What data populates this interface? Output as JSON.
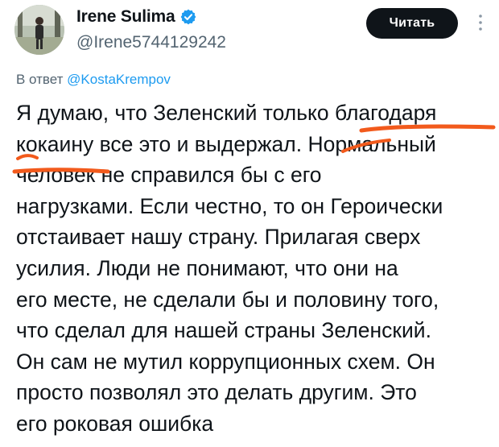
{
  "author": {
    "display_name": "Irene Sulima",
    "handle": "@Irene5744129242",
    "avatar_icon": "avatar-photo",
    "verified_icon": "verified-badge-icon",
    "verified_color": "#1d9bf0"
  },
  "follow_button": {
    "label": "Читать"
  },
  "more_icon": "more-vertical-icon",
  "reply": {
    "prefix": "В ответ ",
    "mention": "@KostaKrempov"
  },
  "tweet": {
    "lines": [
      "Я думаю, что Зеленский только благодаря",
      "кокаину все это и выдержал. Нормальный",
      "человек не справился бы с его",
      "нагрузками. Если честно, то он Героически",
      "отстаивает нашу страну. Прилагая сверх",
      "усилия. Люди не понимают, что они на",
      "его месте, не сделали бы и половину того,",
      "что сделал для нашей страны Зеленский.",
      "Он сам не мутил коррупционных схем. Он",
      "просто позволял это делать другим. Это",
      "его роковая ошибка"
    ]
  },
  "colors": {
    "text": "#0f1419",
    "secondary": "#536471",
    "link": "#1d9bf0",
    "highlight": "#f25a1c",
    "button_bg": "#0f1419"
  }
}
